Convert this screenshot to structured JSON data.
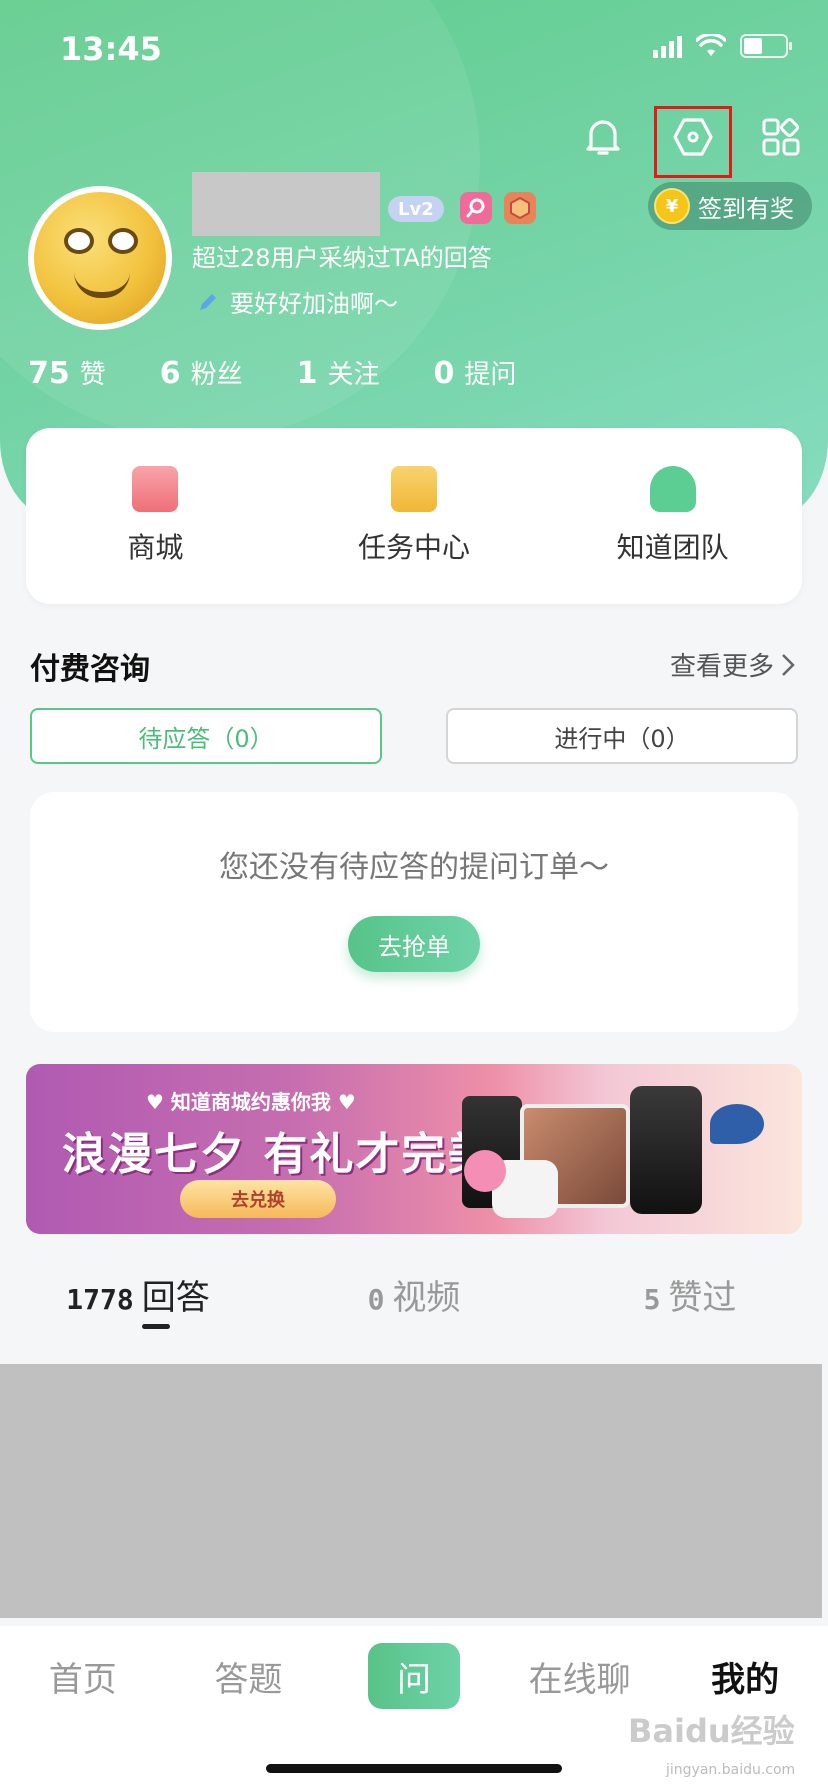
{
  "status_bar": {
    "time": "13:45"
  },
  "header": {
    "sign_in_label": "签到有奖",
    "coin_symbol": "¥",
    "level": "Lv2",
    "description": "超过28用户采纳过TA的回答",
    "motto": "要好好加油啊～",
    "stats": [
      {
        "num": "75",
        "label": "赞"
      },
      {
        "num": "6",
        "label": "粉丝"
      },
      {
        "num": "1",
        "label": "关注"
      },
      {
        "num": "0",
        "label": "提问"
      }
    ]
  },
  "quick_links": [
    {
      "label": "商城",
      "icon": "shopping-bag-icon",
      "color": "#f27d84"
    },
    {
      "label": "任务中心",
      "icon": "calendar-task-icon",
      "color": "#f5c44a"
    },
    {
      "label": "知道团队",
      "icon": "team-icon",
      "color": "#5ccd93"
    }
  ],
  "paid_consult": {
    "title": "付费咨询",
    "more": "查看更多",
    "tab_pending": "待应答（0）",
    "tab_in_progress": "进行中（0）",
    "empty_text": "您还没有待应答的提问订单～",
    "grab_button": "去抢单"
  },
  "banner": {
    "subtitle": "♥ 知道商城约惠你我 ♥",
    "headline": "浪漫七夕 有礼才完美",
    "button": "去兑换"
  },
  "content_tabs": [
    {
      "num": "1778",
      "label": "回答",
      "active": true
    },
    {
      "num": "0",
      "label": "视频",
      "active": false
    },
    {
      "num": "5",
      "label": "赞过",
      "active": false
    }
  ],
  "bottom_nav": {
    "home": "首页",
    "answer": "答题",
    "ask": "问",
    "chat": "在线聊",
    "mine": "我的"
  },
  "watermark": {
    "main": "Baidu经验",
    "sub": "jingyan.baidu.com"
  },
  "colors": {
    "accent": "#58c884",
    "highlight_box": "#e01b1b"
  }
}
